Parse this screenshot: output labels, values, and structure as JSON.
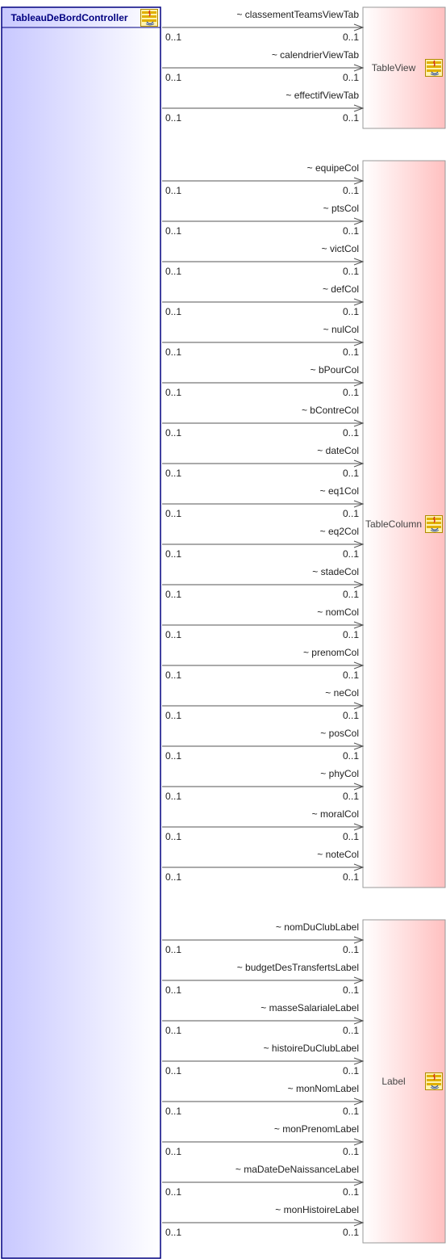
{
  "controller": {
    "name": "TableauDeBordController",
    "icon": "java-class-icon"
  },
  "targets": [
    {
      "name": "TableView",
      "icon": "java-class-icon",
      "associations": [
        {
          "role": "~ classementTeamsViewTab",
          "source_mult": "0..1",
          "target_mult": "0..1"
        },
        {
          "role": "~ calendrierViewTab",
          "source_mult": "0..1",
          "target_mult": "0..1"
        },
        {
          "role": "~ effectifViewTab",
          "source_mult": "0..1",
          "target_mult": "0..1"
        }
      ]
    },
    {
      "name": "TableColumn",
      "icon": "java-class-icon",
      "associations": [
        {
          "role": "~ equipeCol",
          "source_mult": "0..1",
          "target_mult": "0..1"
        },
        {
          "role": "~ ptsCol",
          "source_mult": "0..1",
          "target_mult": "0..1"
        },
        {
          "role": "~ victCol",
          "source_mult": "0..1",
          "target_mult": "0..1"
        },
        {
          "role": "~ defCol",
          "source_mult": "0..1",
          "target_mult": "0..1"
        },
        {
          "role": "~ nulCol",
          "source_mult": "0..1",
          "target_mult": "0..1"
        },
        {
          "role": "~ bPourCol",
          "source_mult": "0..1",
          "target_mult": "0..1"
        },
        {
          "role": "~ bContreCol",
          "source_mult": "0..1",
          "target_mult": "0..1"
        },
        {
          "role": "~ dateCol",
          "source_mult": "0..1",
          "target_mult": "0..1"
        },
        {
          "role": "~ eq1Col",
          "source_mult": "0..1",
          "target_mult": "0..1"
        },
        {
          "role": "~ eq2Col",
          "source_mult": "0..1",
          "target_mult": "0..1"
        },
        {
          "role": "~ stadeCol",
          "source_mult": "0..1",
          "target_mult": "0..1"
        },
        {
          "role": "~ nomCol",
          "source_mult": "0..1",
          "target_mult": "0..1"
        },
        {
          "role": "~ prenomCol",
          "source_mult": "0..1",
          "target_mult": "0..1"
        },
        {
          "role": "~ neCol",
          "source_mult": "0..1",
          "target_mult": "0..1"
        },
        {
          "role": "~ posCol",
          "source_mult": "0..1",
          "target_mult": "0..1"
        },
        {
          "role": "~ phyCol",
          "source_mult": "0..1",
          "target_mult": "0..1"
        },
        {
          "role": "~ moralCol",
          "source_mult": "0..1",
          "target_mult": "0..1"
        },
        {
          "role": "~ noteCol",
          "source_mult": "0..1",
          "target_mult": "0..1"
        }
      ]
    },
    {
      "name": "Label",
      "icon": "java-class-icon",
      "associations": [
        {
          "role": "~ nomDuClubLabel",
          "source_mult": "0..1",
          "target_mult": "0..1"
        },
        {
          "role": "~ budgetDesTransfertsLabel",
          "source_mult": "0..1",
          "target_mult": "0..1"
        },
        {
          "role": "~ masseSalarialeLabel",
          "source_mult": "0..1",
          "target_mult": "0..1"
        },
        {
          "role": "~ histoireDuClubLabel",
          "source_mult": "0..1",
          "target_mult": "0..1"
        },
        {
          "role": "~ monNomLabel",
          "source_mult": "0..1",
          "target_mult": "0..1"
        },
        {
          "role": "~ monPrenomLabel",
          "source_mult": "0..1",
          "target_mult": "0..1"
        },
        {
          "role": "~ maDateDeNaissanceLabel",
          "source_mult": "0..1",
          "target_mult": "0..1"
        },
        {
          "role": "~ monHistoireLabel",
          "source_mult": "0..1",
          "target_mult": "0..1"
        }
      ]
    }
  ],
  "colors": {
    "controller_border": "#000080",
    "controller_fill_start": "#c8c8ff",
    "controller_fill_end": "#ffffff",
    "target_border": "#999999",
    "target_fill_start": "#ffffff",
    "target_fill_end": "#ffc0c0",
    "line": "#555555"
  }
}
